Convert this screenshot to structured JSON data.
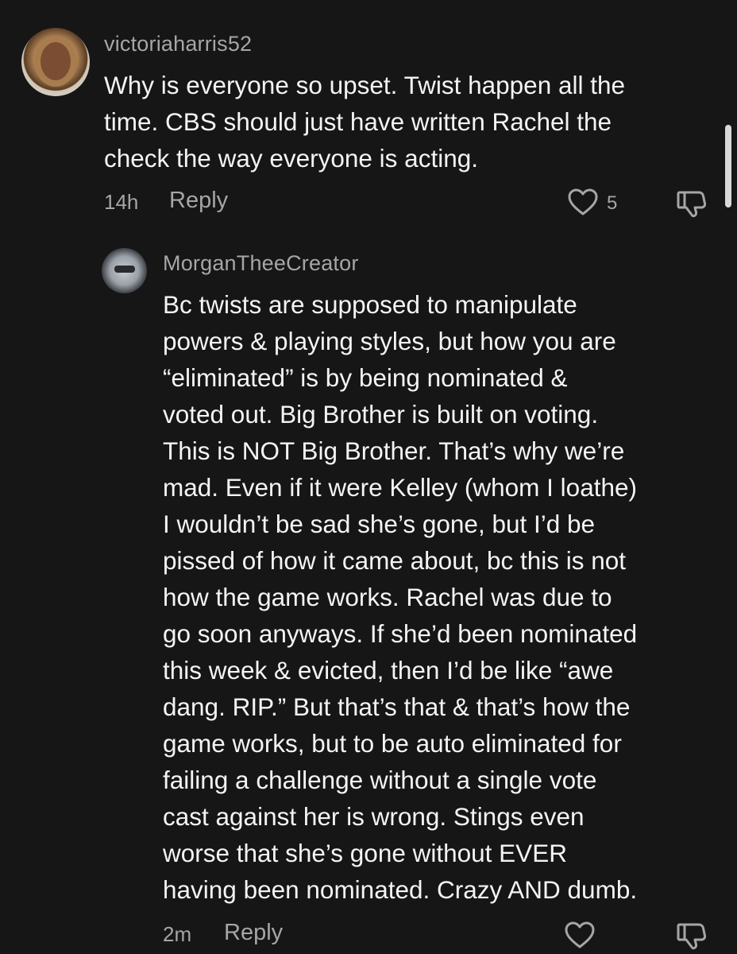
{
  "comments": [
    {
      "username": "victoriaharris52",
      "lines": [
        "Why is everyone so upset. Twist happen all the",
        "time. CBS should just have written Rachel the",
        "check the way everyone is acting."
      ],
      "time": "14h",
      "reply_label": "Reply",
      "likes": "5"
    },
    {
      "username": "MorganTheeCreator",
      "lines": [
        "Bc twists are supposed to manipulate",
        "powers & playing styles, but how you are",
        "“eliminated” is by being nominated &",
        "voted out. Big Brother is built on voting.",
        "This is NOT Big Brother. That’s why we’re",
        "mad. Even if it were Kelley (whom I loathe)",
        "I wouldn’t be sad she’s gone, but I’d be",
        "pissed of how it came about, bc this is not",
        "how the game works. Rachel was due to",
        "go soon anyways. If she’d been nominated",
        "this week & evicted, then I’d be like “awe",
        "dang. RIP.” But that’s that & that’s how the",
        "game works, but to be auto eliminated for",
        "failing a challenge without a single vote",
        "cast against her is wrong. Stings even",
        "worse that she’s gone without EVER",
        "having been nominated. Crazy AND dumb."
      ],
      "time": "2m",
      "reply_label": "Reply",
      "likes": ""
    }
  ],
  "icons": {
    "like": "heart-outline-icon",
    "dislike": "thumbs-down-outline-icon"
  },
  "colors": {
    "background": "#161616",
    "text": "#f4f4f4",
    "muted": "#a6a6a6"
  }
}
